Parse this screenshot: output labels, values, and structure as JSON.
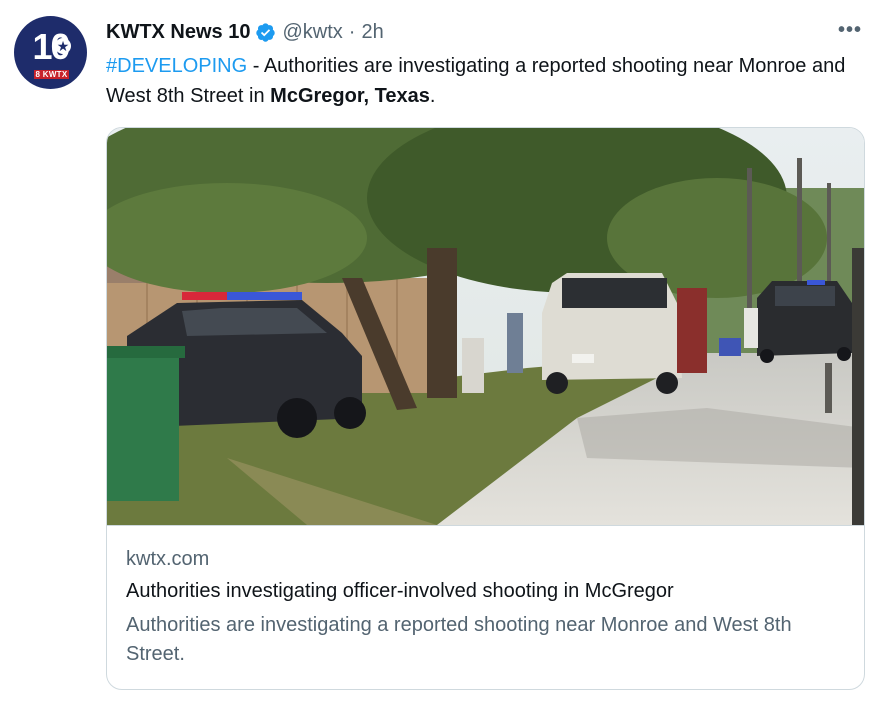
{
  "tweet": {
    "avatar": {
      "number": "10",
      "band": "8 KWTX"
    },
    "author_name": "KWTX News 10",
    "verified_icon": "verified-badge-icon",
    "handle": "@kwtx",
    "separator": "·",
    "time": "2h",
    "more_icon": "more-options-icon",
    "text": {
      "hashtag": "#DEVELOPING",
      "part1": " - Authorities are investigating a reported shooting near Monroe and West 8th Street in ",
      "bold": "McGregor, Texas",
      "part2": "."
    },
    "card": {
      "image_alt": "Police cars and pickup trucks parked on a tree-lined street",
      "domain": "kwtx.com",
      "title": "Authorities investigating officer-involved shooting in McGregor",
      "description": "Authorities are investigating a reported shooting near Monroe and West 8th Street."
    }
  },
  "colors": {
    "link": "#1d9bf0",
    "secondary_text": "#536471",
    "border": "#cfd9de",
    "avatar_bg": "#1e2c6b",
    "avatar_band": "#c8232c"
  }
}
